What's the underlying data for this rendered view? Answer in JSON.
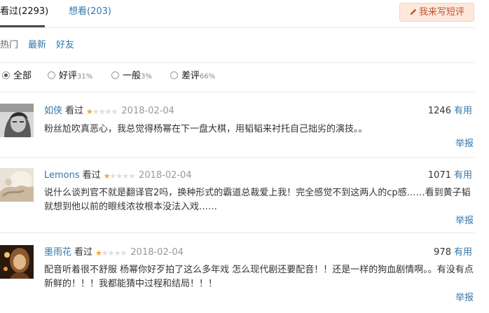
{
  "tabs": {
    "watched": "看过(2293)",
    "want": "想看(203)"
  },
  "write_button": "我来写短评",
  "sort": {
    "hot": "热门",
    "latest": "最新",
    "friends": "好友"
  },
  "filters": [
    {
      "label": "全部",
      "pct": "",
      "checked": true
    },
    {
      "label": "好评",
      "pct": "31%",
      "checked": false
    },
    {
      "label": "一般",
      "pct": "3%",
      "checked": false
    },
    {
      "label": "差评",
      "pct": "66%",
      "checked": false
    }
  ],
  "comments": [
    {
      "user": "如侠",
      "status": "看过",
      "rating": 1,
      "date": "2018-02-04",
      "votes": "1246",
      "useful": "有用",
      "text": "粉丝尬吹真恶心，我总觉得杨幂在下一盘大棋，用韬韬来衬托自己拙劣的演技。。",
      "report": "举报"
    },
    {
      "user": "Lemons",
      "status": "看过",
      "rating": 1,
      "date": "2018-02-04",
      "votes": "1071",
      "useful": "有用",
      "text": "说什么谈判官不就是翻译官2吗，换种形式的霸道总裁爱上我！完全感觉不到这两人的cp感……看到黄子韬就想到他以前的眼线浓妆根本没法入戏……",
      "report": "举报"
    },
    {
      "user": "墨雨花",
      "status": "看过",
      "rating": 1,
      "date": "2018-02-04",
      "votes": "978",
      "useful": "有用",
      "text": "配音听着很不舒服 杨幂你好歹拍了这么多年戏 怎么现代剧还要配音！！还是一样的狗血剧情啊。。有没有点新鲜的！！！我都能猜中过程和结局！！！",
      "report": "举报"
    }
  ],
  "colors": {
    "link": "#3377aa",
    "star": "#f5a623",
    "button_bg": "#fde8dc",
    "button_text": "#c0562d"
  }
}
